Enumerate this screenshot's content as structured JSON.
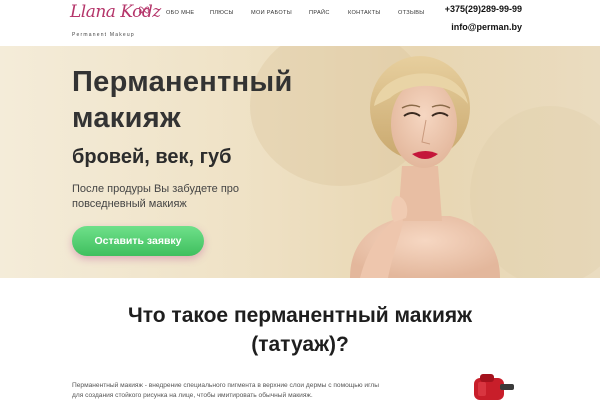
{
  "brand": {
    "logo_script": "Llana Kodz",
    "logo_sub": "Permanent Makeup"
  },
  "nav": {
    "items": [
      {
        "label": "ОБО МНЕ"
      },
      {
        "label": "ПЛЮСЫ"
      },
      {
        "label": "МОИ РАБОТЫ"
      },
      {
        "label": "ПРАЙС"
      },
      {
        "label": "КОНТАКТЫ"
      },
      {
        "label": "ОТЗЫВЫ"
      }
    ]
  },
  "contact": {
    "phone": "+375(29)289-99-99",
    "email": "info@perman.by"
  },
  "hero": {
    "title_line1": "Перманентный",
    "title_line2": "макияж",
    "subtitle": "бровей, век, губ",
    "description": "После продуры Вы забудете про повседневный макияж",
    "cta_label": "Оставить заявку"
  },
  "section": {
    "title_line1": "Что такое перманентный макияж",
    "title_line2": "(татуаж)?",
    "text": "Перманентный макияж - внедрение специального пигмента в верхние слои дермы с помощью иглы для создания стойкого рисунка на лице, чтобы имитировать обычный макияж."
  },
  "colors": {
    "brand": "#b5356a",
    "cta": "#4cc96b",
    "hero_bg": "#efe2c6"
  }
}
